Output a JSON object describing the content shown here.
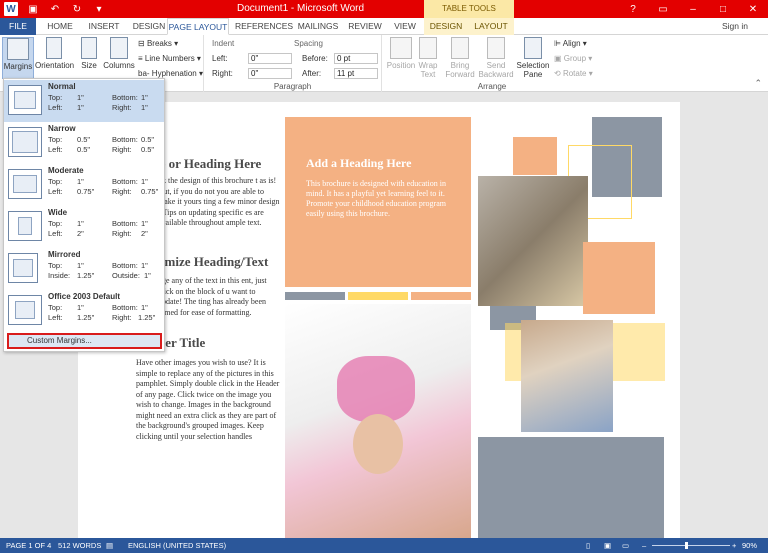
{
  "window": {
    "title": "Document1 - Microsoft Word",
    "context_tab": "TABLE TOOLS",
    "sign_in": "Sign in"
  },
  "tabs": [
    "FILE",
    "HOME",
    "INSERT",
    "DESIGN",
    "PAGE LAYOUT",
    "REFERENCES",
    "MAILINGS",
    "REVIEW",
    "VIEW",
    "DESIGN",
    "LAYOUT"
  ],
  "ribbon": {
    "page_setup": {
      "margins": "Margins",
      "orientation": "Orientation",
      "size": "Size",
      "columns": "Columns",
      "breaks": "Breaks",
      "line_numbers": "Line Numbers",
      "hyphenation": "Hyphenation"
    },
    "paragraph": {
      "label": "Paragraph",
      "indent": "Indent",
      "spacing": "Spacing",
      "left_label": "Left:",
      "right_label": "Right:",
      "before_label": "Before:",
      "after_label": "After:",
      "left_val": "0\"",
      "right_val": "0\"",
      "before_val": "0 pt",
      "after_val": "11 pt"
    },
    "arrange": {
      "label": "Arrange",
      "position": "Position",
      "wrap": "Wrap Text",
      "bring": "Bring Forward",
      "send": "Send Backward",
      "selection": "Selection Pane",
      "align": "Align",
      "group": "Group",
      "rotate": "Rotate"
    }
  },
  "margins_menu": {
    "presets": [
      {
        "name": "Normal",
        "top": "1\"",
        "bottom": "1\"",
        "left": "1\"",
        "right": "1\"",
        "k1": "Left:",
        "k2": "Right:"
      },
      {
        "name": "Narrow",
        "top": "0.5\"",
        "bottom": "0.5\"",
        "left": "0.5\"",
        "right": "0.5\"",
        "k1": "Left:",
        "k2": "Right:"
      },
      {
        "name": "Moderate",
        "top": "1\"",
        "bottom": "1\"",
        "left": "0.75\"",
        "right": "0.75\"",
        "k1": "Left:",
        "k2": "Right:"
      },
      {
        "name": "Wide",
        "top": "1\"",
        "bottom": "1\"",
        "left": "2\"",
        "right": "2\"",
        "k1": "Left:",
        "k2": "Right:"
      },
      {
        "name": "Mirrored",
        "top": "1\"",
        "bottom": "1\"",
        "left": "1.25\"",
        "right": "1\"",
        "k1": "Inside:",
        "k2": "Outside:"
      },
      {
        "name": "Office 2003 Default",
        "top": "1\"",
        "bottom": "1\"",
        "left": "1.25\"",
        "right": "1.25\"",
        "k1": "Left:",
        "k2": "Right:"
      }
    ],
    "top_label": "Top:",
    "bottom_label": "Bottom:",
    "custom": "Custom Margins..."
  },
  "document": {
    "left_heading1": "le or Heading Here",
    "left_body1": "nk the design of this brochure t as is!  But, if you do not you are able to make it yours ting a few minor design !  Tips on updating specific es are available throughout ample text.",
    "left_heading2": "omize Heading/Text",
    "left_body2": "nge any of the text in this ent, just click on the block of u want to update!  The ting has already been mmed for ease of formatting.",
    "left_heading3": "her Title",
    "left_body3": "Have other images you wish to use?  It is simple to replace any of the pictures in this pamphlet.  Simply double click in the Header of any page.  Click twice on the image you wish to change.  Images in the background might need an extra click as they are part of the background's grouped images.  Keep clicking until your selection handles",
    "center_heading": "Add a Heading Here",
    "center_body": "This brochure is designed with education in mind.  It has a playful yet learning feel to it.  Promote your childhood education program easily using this brochure."
  },
  "status": {
    "page": "PAGE 1 OF 4",
    "words": "512 WORDS",
    "language": "ENGLISH (UNITED STATES)",
    "zoom": "90%"
  },
  "colors": {
    "accent": "#2b579a",
    "title_bar": "#e30000",
    "peach": "#f4b183",
    "slate": "#8c96a3",
    "yellow": "#ffd966"
  }
}
